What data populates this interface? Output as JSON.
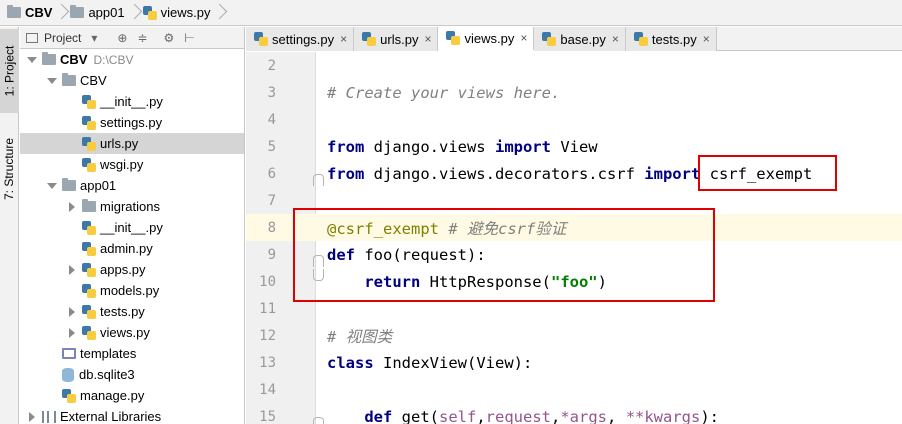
{
  "breadcrumb": {
    "project": "CBV",
    "folder": "app01",
    "file": "views.py"
  },
  "toolstrip": {
    "project_tab": "1: Project",
    "structure_tab": "7: Structure"
  },
  "project_panel": {
    "header_label": "Project",
    "tree": [
      {
        "label": "CBV",
        "hint": "D:\\CBV",
        "kind": "folder",
        "expand": "down",
        "depth": 0,
        "bold": true
      },
      {
        "label": "CBV",
        "kind": "folder",
        "expand": "down",
        "depth": 1
      },
      {
        "label": "__init__.py",
        "kind": "py",
        "expand": "none",
        "depth": 2
      },
      {
        "label": "settings.py",
        "kind": "py",
        "expand": "none",
        "depth": 2
      },
      {
        "label": "urls.py",
        "kind": "py",
        "expand": "none",
        "depth": 2,
        "selected": true
      },
      {
        "label": "wsgi.py",
        "kind": "py",
        "expand": "none",
        "depth": 2
      },
      {
        "label": "app01",
        "kind": "folder",
        "expand": "down",
        "depth": 1
      },
      {
        "label": "migrations",
        "kind": "folder",
        "expand": "right",
        "depth": 2
      },
      {
        "label": "__init__.py",
        "kind": "py",
        "expand": "none",
        "depth": 2
      },
      {
        "label": "admin.py",
        "kind": "py",
        "expand": "none",
        "depth": 2
      },
      {
        "label": "apps.py",
        "kind": "py",
        "expand": "right",
        "depth": 2
      },
      {
        "label": "models.py",
        "kind": "py",
        "expand": "none",
        "depth": 2
      },
      {
        "label": "tests.py",
        "kind": "py",
        "expand": "right",
        "depth": 2
      },
      {
        "label": "views.py",
        "kind": "py",
        "expand": "right",
        "depth": 2
      },
      {
        "label": "templates",
        "kind": "templates",
        "expand": "none",
        "depth": 1
      },
      {
        "label": "db.sqlite3",
        "kind": "db",
        "expand": "none",
        "depth": 1
      },
      {
        "label": "manage.py",
        "kind": "py",
        "expand": "none",
        "depth": 1
      },
      {
        "label": "External Libraries",
        "kind": "lib",
        "expand": "right",
        "depth": 0
      }
    ]
  },
  "editor_tabs": [
    {
      "label": "settings.py",
      "close": "×"
    },
    {
      "label": "urls.py",
      "close": "×"
    },
    {
      "label": "views.py",
      "close": "×",
      "active": true
    },
    {
      "label": "base.py",
      "close": "×"
    },
    {
      "label": "tests.py",
      "close": "×"
    }
  ],
  "code_lines": [
    {
      "num": "2",
      "tokens": []
    },
    {
      "num": "3",
      "tokens": [
        {
          "t": "# Create your views here.",
          "c": "cm"
        }
      ]
    },
    {
      "num": "4",
      "tokens": []
    },
    {
      "num": "5",
      "tokens": [
        {
          "t": "from",
          "c": "kw"
        },
        {
          "t": " django.views "
        },
        {
          "t": "import",
          "c": "kw"
        },
        {
          "t": " View"
        }
      ]
    },
    {
      "num": "6",
      "fold": "top",
      "tokens": [
        {
          "t": "from",
          "c": "kw"
        },
        {
          "t": " django.views.decorators.csrf "
        },
        {
          "t": "import",
          "c": "kw"
        },
        {
          "t": " csrf_exempt"
        }
      ]
    },
    {
      "num": "7",
      "tokens": []
    },
    {
      "num": "8",
      "caret": true,
      "tokens": [
        {
          "t": "@csrf_exempt",
          "c": "dec"
        },
        {
          "t": " "
        },
        {
          "t": "# 避免csrf验证",
          "c": "cm"
        }
      ]
    },
    {
      "num": "9",
      "fold": "top",
      "tokens": [
        {
          "t": "def",
          "c": "kw"
        },
        {
          "t": " foo(request):"
        }
      ]
    },
    {
      "num": "10",
      "fold": "bottom",
      "tokens": [
        {
          "t": "    "
        },
        {
          "t": "return",
          "c": "kw"
        },
        {
          "t": " HttpResponse("
        },
        {
          "t": "\"foo\"",
          "c": "str"
        },
        {
          "t": ")"
        }
      ]
    },
    {
      "num": "11",
      "tokens": []
    },
    {
      "num": "12",
      "tokens": [
        {
          "t": "# 视图类",
          "c": "cm"
        }
      ]
    },
    {
      "num": "13",
      "tokens": [
        {
          "t": "class",
          "c": "kw"
        },
        {
          "t": " IndexView(View):"
        }
      ]
    },
    {
      "num": "14",
      "tokens": []
    },
    {
      "num": "15",
      "fold": "top",
      "tokens": [
        {
          "t": "    "
        },
        {
          "t": "def",
          "c": "kw"
        },
        {
          "t": " get("
        },
        {
          "t": "self",
          "c": "self"
        },
        {
          "t": ","
        },
        {
          "t": "request",
          "c": "param"
        },
        {
          "t": ","
        },
        {
          "t": "*args",
          "c": "param"
        },
        {
          "t": ", "
        },
        {
          "t": "**kwargs",
          "c": "param"
        },
        {
          "t": "):"
        }
      ]
    }
  ],
  "colors": {
    "highlight_border": "#e00000",
    "keyword": "#000080",
    "comment": "#808080",
    "decorator": "#808000",
    "string": "#008000"
  }
}
